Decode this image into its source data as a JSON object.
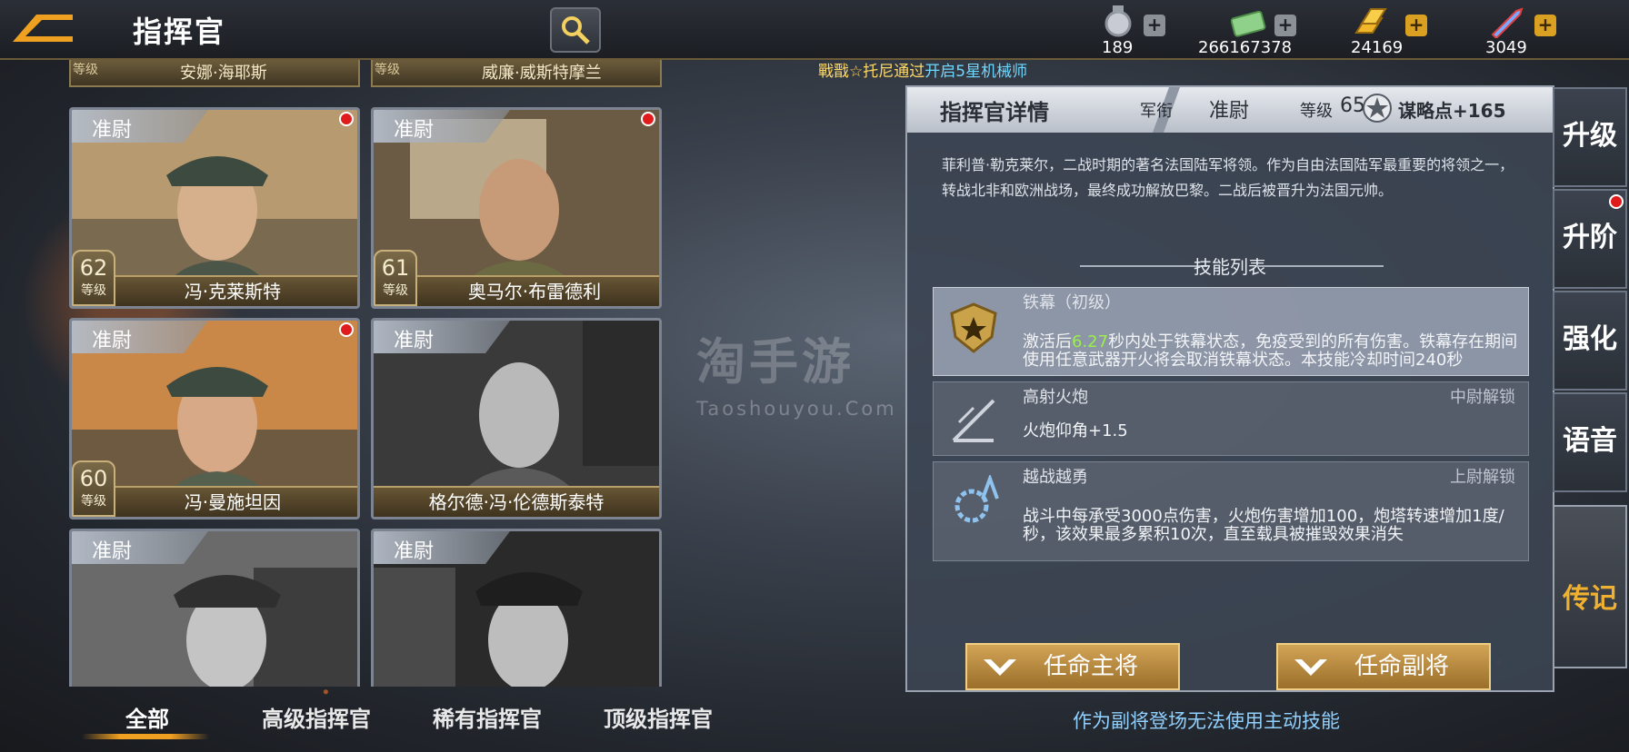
{
  "header": {
    "title": "指挥官"
  },
  "resources": [
    {
      "icon": "medal-icon",
      "value": "189",
      "plus": "+"
    },
    {
      "icon": "cash-icon",
      "value": "266167378",
      "plus": "+"
    },
    {
      "icon": "gold-bars-icon",
      "value": "24169",
      "plus": "+"
    },
    {
      "icon": "rocket-icon",
      "value": "3049",
      "plus": "+"
    }
  ],
  "ticker": {
    "player": "戰戬☆托尼",
    "mid": "通过",
    "event": "开启5星机械师"
  },
  "peek_cards": [
    {
      "level_label": "等级",
      "name": "安娜·海耶斯"
    },
    {
      "level_label": "等级",
      "name": "威廉·威斯特摩兰"
    }
  ],
  "commanders": [
    {
      "rank": "准尉",
      "name": "冯·克莱斯特",
      "level": "62",
      "level_label": "等级",
      "has_alert": true
    },
    {
      "rank": "准尉",
      "name": "奥马尔·布雷德利",
      "level": "61",
      "level_label": "等级",
      "has_alert": true
    },
    {
      "rank": "准尉",
      "name": "冯·曼施坦因",
      "level": "60",
      "level_label": "等级",
      "has_alert": true
    },
    {
      "rank": "准尉",
      "name": "格尔德·冯·伦德斯泰特",
      "level": "",
      "level_label": "",
      "has_alert": false
    },
    {
      "rank": "准尉",
      "name": "",
      "level": "",
      "level_label": "",
      "has_alert": false
    },
    {
      "rank": "准尉",
      "name": "",
      "level": "",
      "level_label": "",
      "has_alert": false
    }
  ],
  "filter_tabs": [
    "全部",
    "高级指挥官",
    "稀有指挥官",
    "顶级指挥官"
  ],
  "details": {
    "title": "指挥官详情",
    "rank_label": "军衔",
    "rank_value": "准尉",
    "level_label": "等级",
    "level_value": "65",
    "strategy_points": "谋略点+165",
    "bio": "菲利普·勒克莱尔，二战时期的著名法国陆军将领。作为自由法国陆军最重要的将领之一，转战北非和欧洲战场，最终成功解放巴黎。二战后被晋升为法国元帅。",
    "skills_title": "技能列表",
    "skills": [
      {
        "name": "铁幕（初级）",
        "lock": "",
        "icon": "shield-star-icon",
        "desc_pre": "激活后",
        "desc_hl": "6.27",
        "desc_post": "秒内处于铁幕状态，免疫受到的所有伤害。铁幕存在期间使用任意武器开火将会取消铁幕状态。本技能冷却时间240秒"
      },
      {
        "name": "高射火炮",
        "lock": "中尉解锁",
        "icon": "artillery-angle-icon",
        "desc": "火炮仰角+1.5"
      },
      {
        "name": "越战越勇",
        "lock": "上尉解锁",
        "icon": "gear-arrow-icon",
        "desc": "战斗中每承受3000点伤害，火炮伤害增加100，炮塔转速增加1度/秒，该效果最多累积10次，直至载具被摧毁效果消失"
      }
    ],
    "buttons": {
      "main": "任命主将",
      "deputy": "任命副将"
    },
    "note": "作为副将登场无法使用主动技能"
  },
  "side_tabs": [
    {
      "label": "升级",
      "alert": false
    },
    {
      "label": "升阶",
      "alert": true
    },
    {
      "label": "强化",
      "alert": false
    },
    {
      "label": "语音",
      "alert": false
    },
    {
      "label": "传记",
      "alert": false
    }
  ],
  "watermark": {
    "main": "淘手游",
    "sub": "Taoshouyou.Com"
  },
  "colors": {
    "accent_gold": "#d2a456",
    "alert_red": "#e01b1b",
    "highlight_green": "#9af04a",
    "note_blue": "#8fd0ff"
  }
}
